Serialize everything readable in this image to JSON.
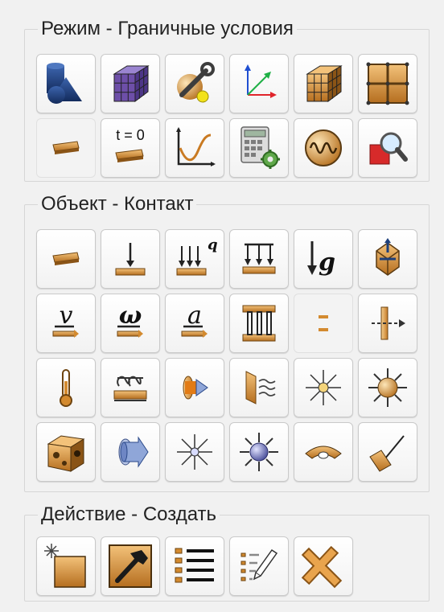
{
  "groups": {
    "mode": {
      "title": "Режим - Граничные условия",
      "buttons": [
        {
          "icon": "geometry-shapes-icon"
        },
        {
          "icon": "mesh-cube-icon"
        },
        {
          "icon": "material-settings-icon"
        },
        {
          "icon": "coordinate-axes-icon"
        },
        {
          "icon": "meshed-solid-icon"
        },
        {
          "icon": "grid-layout-icon"
        },
        {
          "icon": "boundary-conditions-icon"
        },
        {
          "icon": "initial-conditions-icon",
          "text": "t = 0"
        },
        {
          "icon": "time-function-icon"
        },
        {
          "icon": "calculation-icon"
        },
        {
          "icon": "oscillation-icon"
        },
        {
          "icon": "result-inspect-icon"
        }
      ]
    },
    "object": {
      "title": "Объект - Контакт",
      "buttons": [
        {
          "icon": "contact-surface-icon"
        },
        {
          "icon": "force-icon"
        },
        {
          "icon": "distributed-load-icon",
          "text": "q"
        },
        {
          "icon": "pressure-icon"
        },
        {
          "icon": "gravity-icon",
          "text": "g"
        },
        {
          "icon": "rotation-center-icon"
        },
        {
          "icon": "velocity-icon",
          "text": "v"
        },
        {
          "icon": "angular-velocity-icon",
          "text": "ω"
        },
        {
          "icon": "acceleration-icon",
          "text": "a"
        },
        {
          "icon": "rigid-connection-icon"
        },
        {
          "icon": "gap-icon"
        },
        {
          "icon": "displacement-icon"
        },
        {
          "icon": "temperature-icon"
        },
        {
          "icon": "heat-source-icon"
        },
        {
          "icon": "heat-flux-icon"
        },
        {
          "icon": "convection-icon"
        },
        {
          "icon": "radiation-icon"
        },
        {
          "icon": "point-heat-source-icon"
        },
        {
          "icon": "volume-heat-icon"
        },
        {
          "icon": "flow-icon"
        },
        {
          "icon": "radiation-light-icon"
        },
        {
          "icon": "radiation-source-icon"
        },
        {
          "icon": "bend-icon"
        },
        {
          "icon": "measure-icon"
        }
      ]
    },
    "action": {
      "title": "Действие - Создать",
      "buttons": [
        {
          "icon": "create-new-icon"
        },
        {
          "icon": "edit-hammer-icon"
        },
        {
          "icon": "list-icon"
        },
        {
          "icon": "edit-list-icon"
        },
        {
          "icon": "delete-icon"
        }
      ]
    }
  },
  "colors": {
    "brand_orange": "#d38a2f",
    "orange_dark": "#8a5416",
    "navy": "#1f3e78",
    "purple": "#6d4fa8"
  }
}
